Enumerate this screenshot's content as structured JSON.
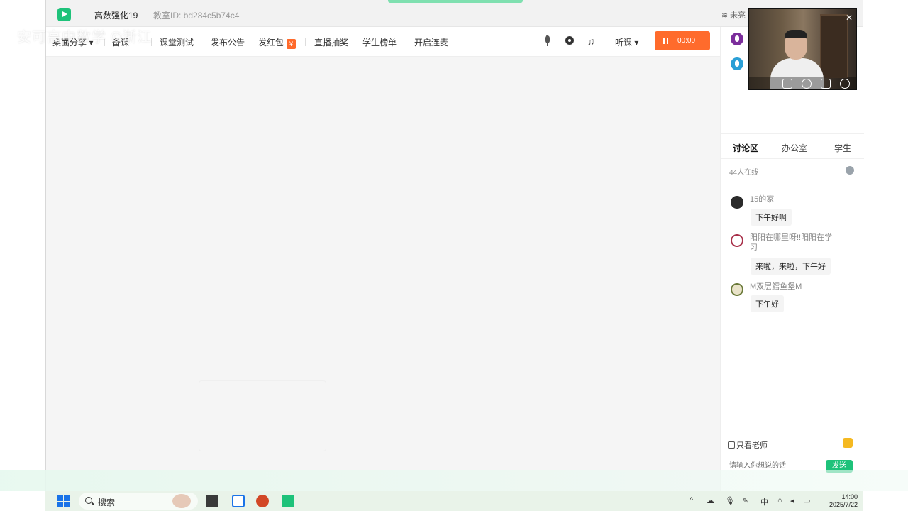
{
  "window": {
    "course_title": "高数强化19",
    "room_id": "教室ID: bd284c5b74c4",
    "network_status": "未亮"
  },
  "overlay_text": "安可高中数学 ©浙江",
  "toolbar": {
    "items": [
      {
        "label": "桌面分享 ▾"
      },
      {
        "label": "备课"
      },
      {
        "label": "课堂测试"
      },
      {
        "label": "发布公告"
      },
      {
        "label": "发红包"
      },
      {
        "label": "直播抽奖"
      },
      {
        "label": "学生榜单"
      },
      {
        "label": "开启连麦"
      }
    ],
    "redpacket_badge": "¥",
    "listen_label": "听课 ▾",
    "record_time": "00:00",
    "accent": "#ff6b2c"
  },
  "sidebar": {
    "tabs": [
      "讨论区",
      "办公室",
      "学生"
    ],
    "active_tab": "讨论区",
    "online_count": "44人在线",
    "messages": [
      {
        "name": "15的家",
        "text": "下午好啊",
        "avatar_color": "#2b2b2b"
      },
      {
        "name": "阳阳在哪里呀!!阳阳在学习",
        "text": "来啦，来啦，下午好",
        "avatar_color": "#a8304a"
      },
      {
        "name": "M双层鳕鱼堡M",
        "text": "下午好",
        "avatar_color": "#6b7a3a"
      }
    ],
    "only_teacher_label": "只看老师",
    "input_placeholder": "请输入你想说的话",
    "send_label": "发送",
    "brand_color": "#1ec27a"
  },
  "taskbar": {
    "search_label": "搜索",
    "tray": [
      "^",
      "中"
    ],
    "time": "14:00",
    "date": "2025/7/22"
  }
}
